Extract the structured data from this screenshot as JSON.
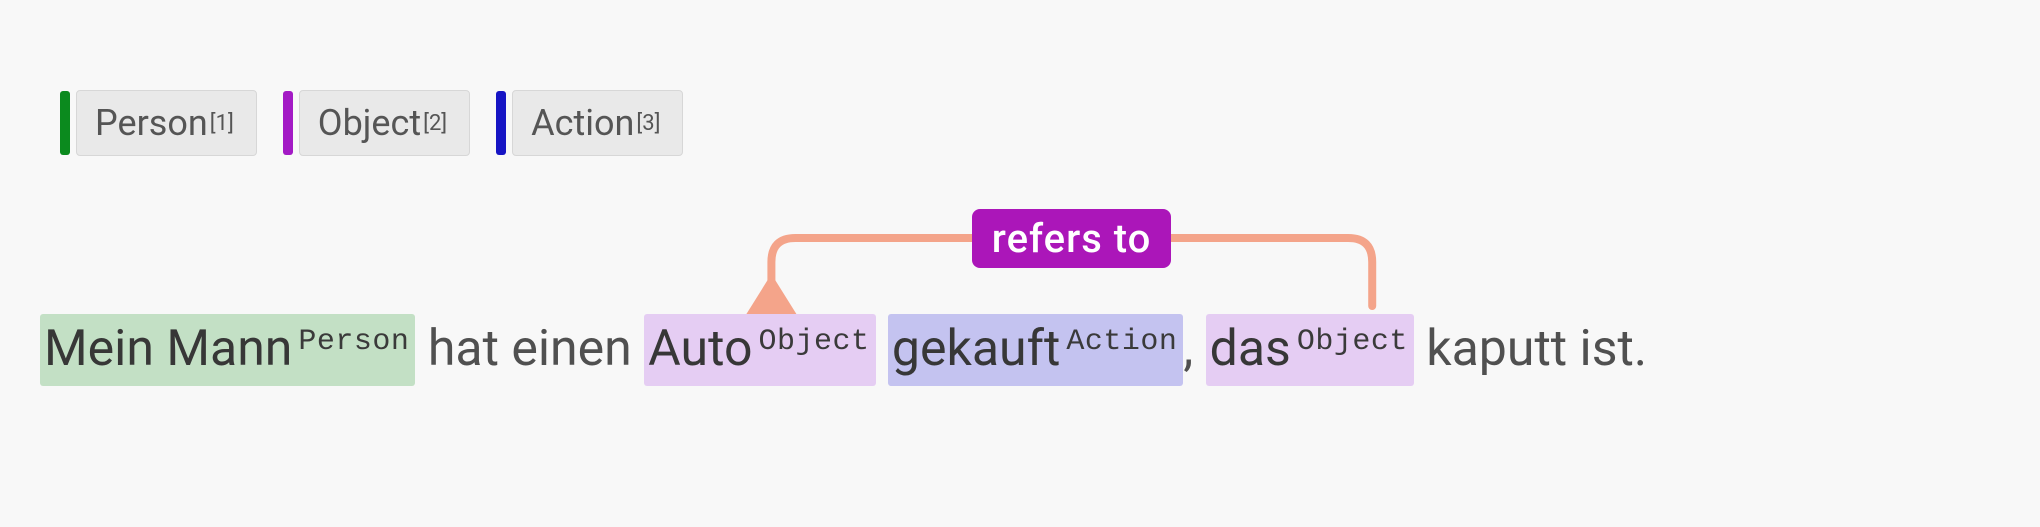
{
  "legend": {
    "items": [
      {
        "name": "Person",
        "index": "[1]",
        "color": "#0b8a1e"
      },
      {
        "name": "Object",
        "index": "[2]",
        "color": "#a31ac5"
      },
      {
        "name": "Action",
        "index": "[3]",
        "color": "#1614c4"
      }
    ]
  },
  "relation": {
    "label": "refers to",
    "color_box": "#ab16b9",
    "arc_color": "#f4a48a"
  },
  "sentence": {
    "tokens": [
      {
        "text": "Mein Mann",
        "tag": "Person",
        "type": "person"
      },
      {
        "text": " hat einen ",
        "type": "plain"
      },
      {
        "text": "Auto",
        "tag": "Object",
        "type": "object"
      },
      {
        "text": " ",
        "type": "plain"
      },
      {
        "text": "gekauft",
        "tag": "Action",
        "type": "action"
      },
      {
        "text": ", ",
        "type": "plain"
      },
      {
        "text": "das",
        "tag": "Object",
        "type": "object"
      },
      {
        "text": " kaputt ist.",
        "type": "plain"
      }
    ]
  },
  "colors": {
    "person_bg": "#c3e0c5",
    "object_bg": "#e5cdf3",
    "action_bg": "#c4c3f0"
  },
  "diagram": {
    "arc": {
      "from_token_index": 6,
      "to_token_index": 2,
      "description": "das → Auto (refers to)"
    }
  }
}
